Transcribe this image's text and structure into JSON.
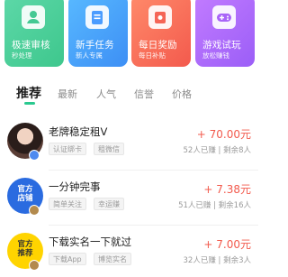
{
  "feature_cards": [
    {
      "title": "极速审核",
      "subtitle": "秒处理",
      "icon": "user-check-icon",
      "color": "#44c993"
    },
    {
      "title": "新手任务",
      "subtitle": "新人专属",
      "icon": "document-icon",
      "color": "#4a9cff"
    },
    {
      "title": "每日奖励",
      "subtitle": "每日补贴",
      "icon": "gift-bag-icon",
      "color": "#f56555"
    },
    {
      "title": "游戏试玩",
      "subtitle": "放松赚钱",
      "icon": "gamepad-icon",
      "color": "#a965f8"
    }
  ],
  "tabs": [
    {
      "label": "推荐",
      "active": true
    },
    {
      "label": "最新",
      "active": false
    },
    {
      "label": "人气",
      "active": false
    },
    {
      "label": "信誉",
      "active": false
    },
    {
      "label": "价格",
      "active": false
    }
  ],
  "tasks": [
    {
      "title": "老牌稳定租V",
      "tags": [
        "认证绑卡",
        "租微信"
      ],
      "price": "+ 70.00元",
      "stats": "52人已赚 | 剩余8人",
      "avatar_text": ""
    },
    {
      "title": "一分钟完事",
      "tags": [
        "简单关注",
        "幸运赚"
      ],
      "price": "+ 7.38元",
      "stats": "51人已赚 | 剩余16人",
      "avatar_text": "官方\n店铺"
    },
    {
      "title": "下载实名一下就过",
      "tags": [
        "下载App",
        "博览实名"
      ],
      "price": "+ 7.00元",
      "stats": "32人已赚 | 剩余3人",
      "avatar_text": "官方\n推荐"
    }
  ]
}
